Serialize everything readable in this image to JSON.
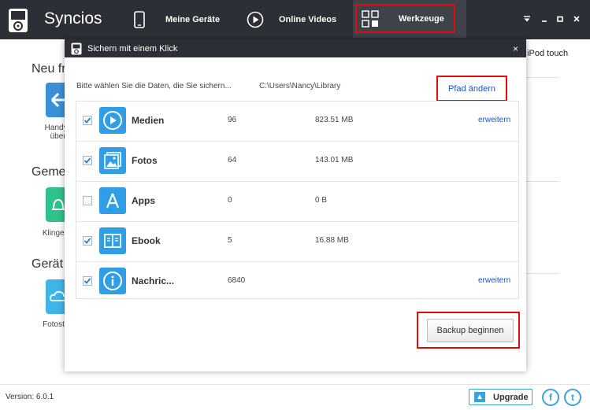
{
  "app": {
    "title": "Syncios",
    "device_label": ": iPod touch"
  },
  "nav": {
    "devices": "Meine Geräte",
    "videos": "Online Videos",
    "tools": "Werkzeuge"
  },
  "background": {
    "section_1": "Neu fr",
    "section_2": "Geme",
    "section_3": "Gerät",
    "tile_1_label_line1": "Handy z",
    "tile_1_label_line2": "übert",
    "tile_2_label": "Klingelto",
    "tile_3_label": "Fotost"
  },
  "footer": {
    "version": "Version: 6.0.1",
    "upgrade": "Upgrade",
    "facebook": "f",
    "twitter": "t"
  },
  "modal": {
    "title": "Sichern mit einem Klick",
    "close": "×",
    "prompt": "Bitte wählen Sie die Daten, die Sie sichern...",
    "path": "C:\\Users\\Nancy\\Library",
    "change_path": "Pfad ändern",
    "backup": "Backup beginnen",
    "items": [
      {
        "name": "Medien",
        "count": "96",
        "size": "823.51 MB",
        "expand": "erweitern",
        "checked": true,
        "icon": "play-icon"
      },
      {
        "name": "Fotos",
        "count": "64",
        "size": "143.01 MB",
        "expand": "",
        "checked": true,
        "icon": "photo-icon"
      },
      {
        "name": "Apps",
        "count": "0",
        "size": "0 B",
        "expand": "",
        "checked": false,
        "icon": "apps-icon"
      },
      {
        "name": "Ebook",
        "count": "5",
        "size": "16.88 MB",
        "expand": "",
        "checked": true,
        "icon": "book-icon"
      },
      {
        "name": "Nachric...",
        "count": "6840",
        "size": "",
        "expand": "erweitern",
        "checked": true,
        "icon": "info-icon"
      }
    ]
  },
  "colors": {
    "topbar": "#2c2f35",
    "accent": "#2f9ee6",
    "highlight": "#e10c0c",
    "link": "#1a56c4"
  }
}
